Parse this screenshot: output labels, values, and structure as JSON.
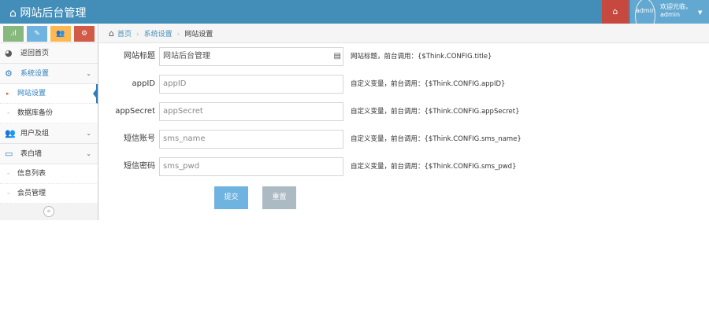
{
  "header": {
    "brand": "网站后台管理",
    "welcome": "欢迎光临，",
    "username": "admin",
    "avatar_alt": "admin"
  },
  "shortcuts": [
    {
      "icon": "signal-icon",
      "color": "#87b87f"
    },
    {
      "icon": "pencil-icon",
      "color": "#6fb3e0"
    },
    {
      "icon": "users-icon",
      "color": "#ffb752"
    },
    {
      "icon": "cogs-icon",
      "color": "#d15b47"
    }
  ],
  "sidebar": {
    "items": [
      {
        "label": "返回首页"
      },
      {
        "label": "系统设置",
        "children": [
          "网站设置",
          "数据库备份"
        ]
      },
      {
        "label": "用户及组"
      },
      {
        "label": "表白墙",
        "children": [
          "信息列表",
          "会员管理"
        ]
      }
    ]
  },
  "breadcrumb": [
    "首页",
    "系统设置",
    "网站设置"
  ],
  "form": {
    "rows": [
      {
        "label": "网站标题",
        "value": "网站后台管理",
        "placeholder": "",
        "hint": "网站标题，前台调用：{$Think.CONFIG.title}"
      },
      {
        "label": "appID",
        "value": "",
        "placeholder": "appID",
        "hint": "自定义变量，前台调用：{$Think.CONFIG.appID}"
      },
      {
        "label": "appSecret",
        "value": "",
        "placeholder": "appSecret",
        "hint": "自定义变量，前台调用：{$Think.CONFIG.appSecret}"
      },
      {
        "label": "短信账号",
        "value": "",
        "placeholder": "sms_name",
        "hint": "自定义变量，前台调用：{$Think.CONFIG.sms_name}"
      },
      {
        "label": "短信密码",
        "value": "",
        "placeholder": "sms_pwd",
        "hint": "自定义变量，前台调用：{$Think.CONFIG.sms_pwd}"
      }
    ],
    "submit": "提交",
    "reset": "重置"
  }
}
